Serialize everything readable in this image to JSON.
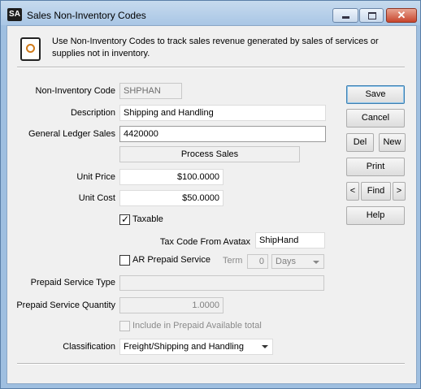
{
  "window": {
    "app_icon": "SA",
    "title": "Sales Non-Inventory Codes",
    "close_glyph": "✕"
  },
  "info": {
    "text": "Use Non-Inventory Codes to track sales revenue generated by sales of services or supplies not in inventory.",
    "icon": "document-gear-icon"
  },
  "form": {
    "code_label": "Non-Inventory Code",
    "code_value": "SHPHAN",
    "description_label": "Description",
    "description_value": "Shipping and Handling",
    "gl_label": "General Ledger Sales",
    "gl_value": "4420000",
    "process_sales_label": "Process Sales",
    "unit_price_label": "Unit Price",
    "unit_price_value": "$100.0000",
    "unit_cost_label": "Unit Cost",
    "unit_cost_value": "$50.0000",
    "taxable_label": "Taxable",
    "taxable_checked": true,
    "tax_code_label": "Tax Code From Avatax",
    "tax_code_value": "ShipHand",
    "ar_prepaid_label": "AR Prepaid Service",
    "ar_prepaid_checked": false,
    "term_label": "Term",
    "term_value": "0",
    "term_unit": "Days",
    "prepaid_type_label": "Prepaid Service Type",
    "prepaid_type_value": "",
    "prepaid_qty_label": "Prepaid Service Quantity",
    "prepaid_qty_value": "1.0000",
    "include_prepaid_label": "Include in Prepaid Available total",
    "classification_label": "Classification",
    "classification_value": "Freight/Shipping and Handling"
  },
  "buttons": {
    "save": "Save",
    "cancel": "Cancel",
    "del": "Del",
    "new": "New",
    "print": "Print",
    "prev": "<",
    "find": "Find",
    "next": ">",
    "help": "Help"
  },
  "check_glyph": "✓"
}
